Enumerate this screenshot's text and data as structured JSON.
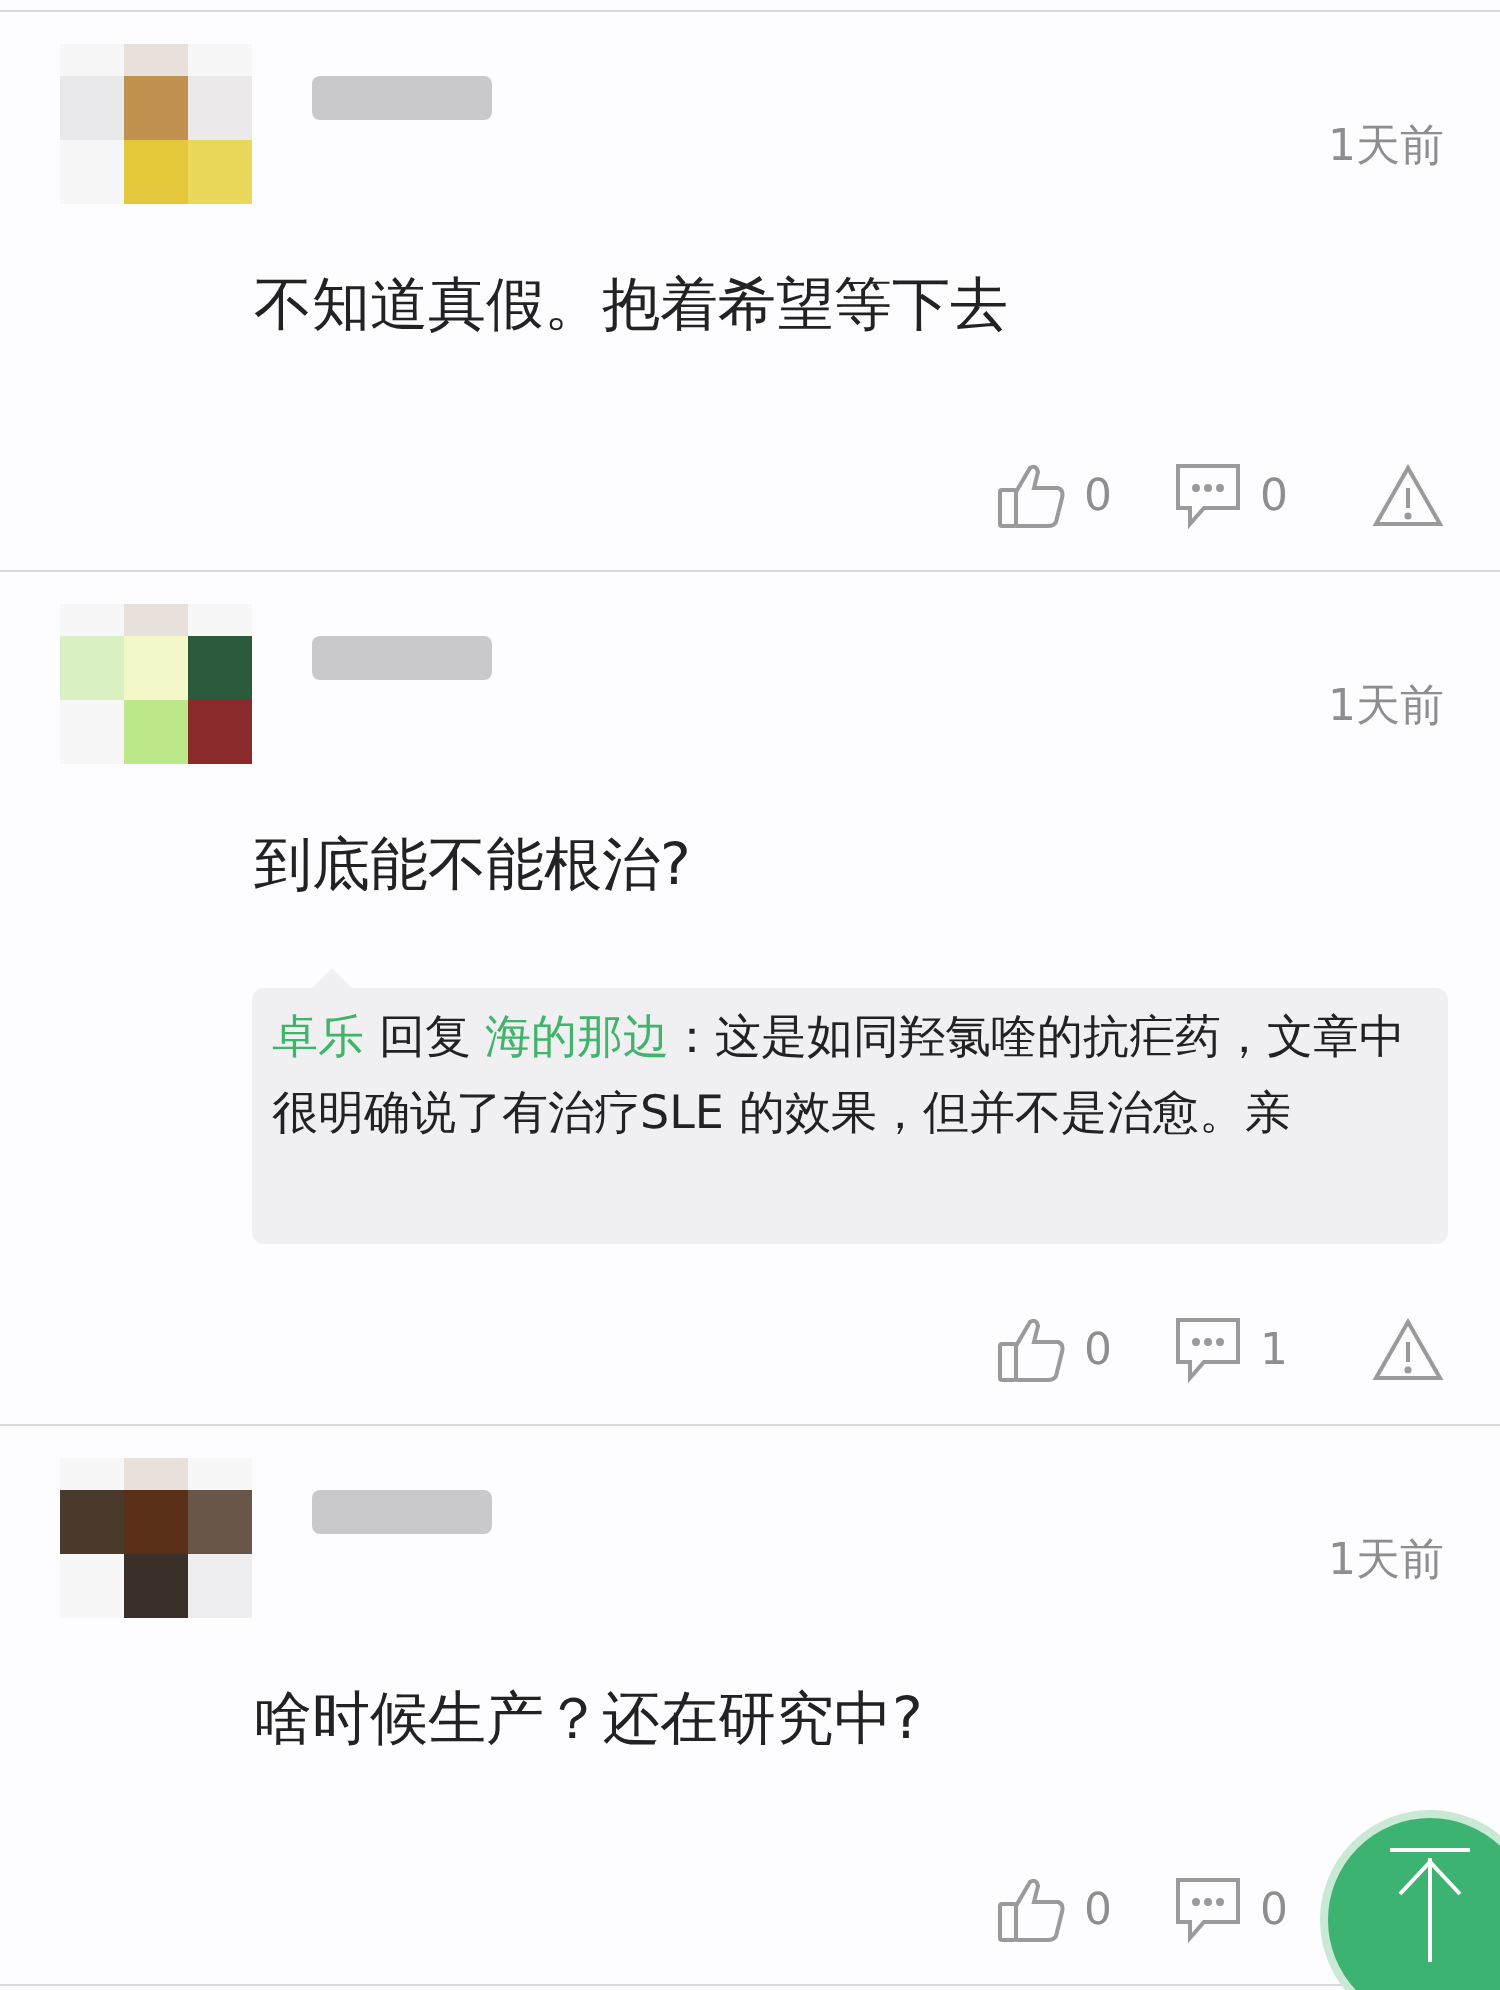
{
  "comments": [
    {
      "time": "1天前",
      "text": "不知道真假。抱着希望等下去",
      "likes": "0",
      "replies": "0",
      "report": true
    },
    {
      "time": "1天前",
      "text": "到底能不能根治?",
      "reply": {
        "author": "卓乐",
        "verb": "回复",
        "target": "海的那边",
        "text": "：这是如同羟氯喹的抗疟药，文章中很明确说了有治疗SLE 的效果，但并不是治愈。亲"
      },
      "likes": "0",
      "replies": "1",
      "report": true
    },
    {
      "time": "1天前",
      "text": "啥时候生产？还在研究中?",
      "likes": "0",
      "replies": "0"
    }
  ],
  "scroll_top_button": {
    "visible": true
  }
}
